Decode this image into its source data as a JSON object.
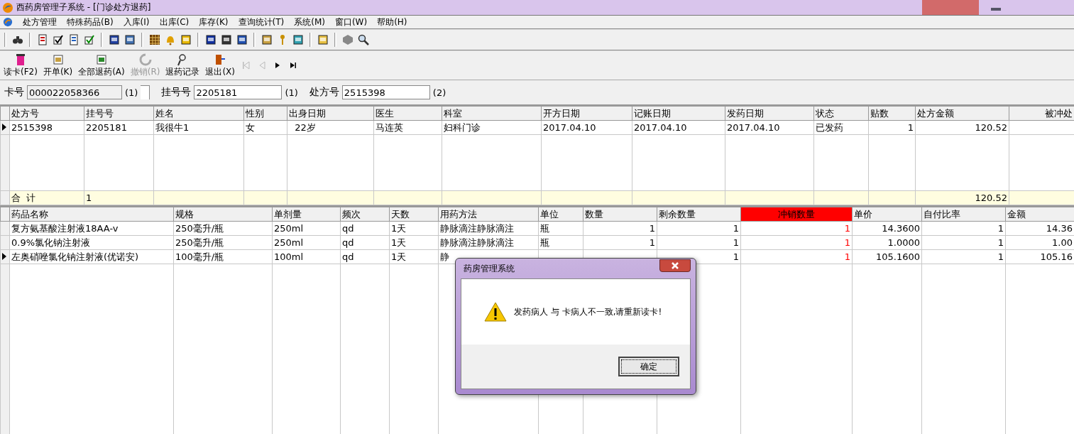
{
  "window": {
    "title": "西药房管理子系统 - [门诊处方退药]"
  },
  "menu": [
    "处方管理",
    "特殊药品(B)",
    "入库(I)",
    "出库(C)",
    "库存(K)",
    "查询统计(T)",
    "系统(M)",
    "窗口(W)",
    "帮助(H)"
  ],
  "actions": [
    {
      "label": "读卡(F2)",
      "disabled": false
    },
    {
      "label": "开单(K)",
      "disabled": false
    },
    {
      "label": "全部退药(A)",
      "disabled": false
    },
    {
      "label": "撤销(R)",
      "disabled": true
    },
    {
      "label": "退药记录",
      "disabled": false
    },
    {
      "label": "退出(X)",
      "disabled": false
    }
  ],
  "navigation": [
    {
      "kind": "first",
      "disabled": true
    },
    {
      "kind": "prev",
      "disabled": true
    },
    {
      "kind": "next",
      "disabled": false
    },
    {
      "kind": "last",
      "disabled": false
    }
  ],
  "fields": [
    {
      "label": "卡号",
      "value": "000022058366",
      "hint": "(1)",
      "readonly": true,
      "extra_box": true
    },
    {
      "label": "挂号号",
      "value": "2205181",
      "hint": "(1)",
      "readonly": false
    },
    {
      "label": "处方号",
      "value": "2515398",
      "hint": "(2)",
      "readonly": false
    }
  ],
  "prescriptions": {
    "columns": [
      {
        "label": "处方号",
        "kind": "text"
      },
      {
        "label": "挂号号",
        "kind": "text"
      },
      {
        "label": "姓名",
        "kind": "text"
      },
      {
        "label": "性别",
        "kind": "text"
      },
      {
        "label": "出身日期",
        "kind": "text"
      },
      {
        "label": "医生",
        "kind": "text"
      },
      {
        "label": "科室",
        "kind": "text"
      },
      {
        "label": "开方日期",
        "kind": "text"
      },
      {
        "label": "记账日期",
        "kind": "text"
      },
      {
        "label": "发药日期",
        "kind": "text"
      },
      {
        "label": "状态",
        "kind": "text"
      },
      {
        "label": "贴数",
        "kind": "number"
      },
      {
        "label": "处方金额",
        "kind": "number"
      },
      {
        "label": "被冲处",
        "kind": "number"
      }
    ],
    "rows": [
      {
        "current": true,
        "cells": [
          "2515398",
          "2205181",
          "我很牛1",
          "女",
          "  22岁",
          "马连英",
          "妇科门诊",
          "2017.04.10",
          "2017.04.10",
          "2017.04.10",
          "已发药",
          "1",
          "120.52",
          null
        ]
      }
    ],
    "total": {
      "label": "合  计",
      "count": "1",
      "amount": "120.52"
    }
  },
  "items": {
    "columns": [
      {
        "label": "药品名称",
        "kind": "text",
        "highlighted": false
      },
      {
        "label": "规格",
        "kind": "text",
        "highlighted": false
      },
      {
        "label": "单剂量",
        "kind": "text",
        "highlighted": false
      },
      {
        "label": "频次",
        "kind": "text",
        "highlighted": false
      },
      {
        "label": "天数",
        "kind": "text",
        "highlighted": false
      },
      {
        "label": "用药方法",
        "kind": "text",
        "highlighted": false
      },
      {
        "label": "单位",
        "kind": "text",
        "highlighted": false
      },
      {
        "label": "数量",
        "kind": "number",
        "highlighted": false
      },
      {
        "label": "剩余数量",
        "kind": "number",
        "highlighted": false
      },
      {
        "label": "冲销数量",
        "kind": "number",
        "highlighted": true
      },
      {
        "label": "单价",
        "kind": "number",
        "highlighted": false
      },
      {
        "label": "自付比率",
        "kind": "number",
        "highlighted": false
      },
      {
        "label": "金额",
        "kind": "number",
        "highlighted": false
      }
    ],
    "rows": [
      {
        "current": false,
        "cells": [
          "复方氨基酸注射液18AA-v",
          "250毫升/瓶",
          "250ml",
          "qd",
          "1天",
          "静脉滴注静脉滴注",
          "瓶",
          "1",
          "1",
          "1",
          "14.3600",
          "1",
          "14.36"
        ]
      },
      {
        "current": false,
        "cells": [
          "0.9%氯化钠注射液",
          "250毫升/瓶",
          "250ml",
          "qd",
          "1天",
          "静脉滴注静脉滴注",
          "瓶",
          "1",
          "1",
          "1",
          "1.0000",
          "1",
          "1.00"
        ]
      },
      {
        "current": true,
        "cells": [
          "左奥硝唑氯化钠注射液(优诺安)",
          "100毫升/瓶",
          "100ml",
          "qd",
          "1天",
          "静",
          null,
          null,
          "1",
          "1",
          "105.1600",
          "1",
          "105.16"
        ]
      }
    ]
  },
  "dialog": {
    "title": "药房管理系统",
    "message": "发药病人 与 卡病人不一致,请重新读卡!",
    "button": "确定"
  }
}
